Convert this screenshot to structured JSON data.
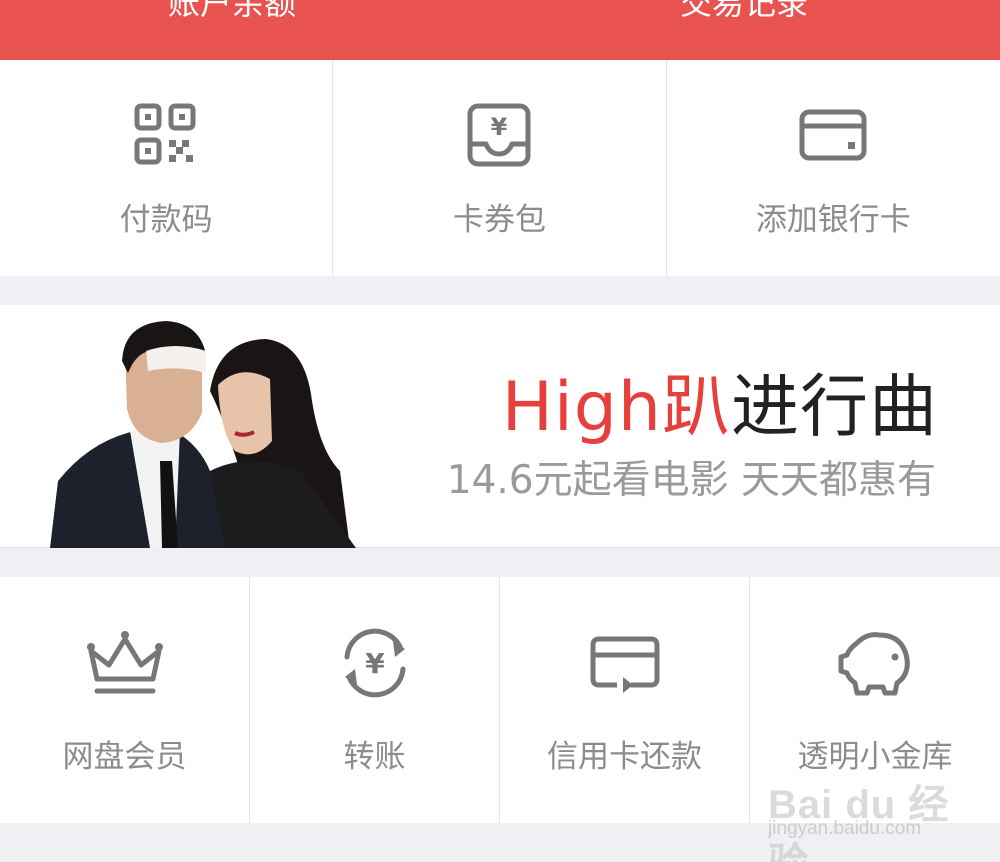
{
  "header": {
    "left_label": "账户余额",
    "right_label": "交易记录",
    "bg_color": "#e85350"
  },
  "quick_actions": [
    {
      "label": "付款码",
      "icon": "qr-code-icon"
    },
    {
      "label": "卡券包",
      "icon": "coupon-wallet-icon"
    },
    {
      "label": "添加银行卡",
      "icon": "bank-card-icon"
    }
  ],
  "banner": {
    "title_highlight": "High趴",
    "title_rest": "进行曲",
    "subtitle": "14.6元起看电影 天天都惠有",
    "highlight_color": "#e6403c"
  },
  "services": [
    {
      "label": "网盘会员",
      "icon": "crown-icon"
    },
    {
      "label": "转账",
      "icon": "transfer-yen-icon"
    },
    {
      "label": "信用卡还款",
      "icon": "credit-card-repay-icon"
    },
    {
      "label": "透明小金库",
      "icon": "piggy-bank-icon"
    }
  ],
  "watermark": {
    "brand": "Bai du 经验",
    "url": "jingyan.baidu.com"
  }
}
